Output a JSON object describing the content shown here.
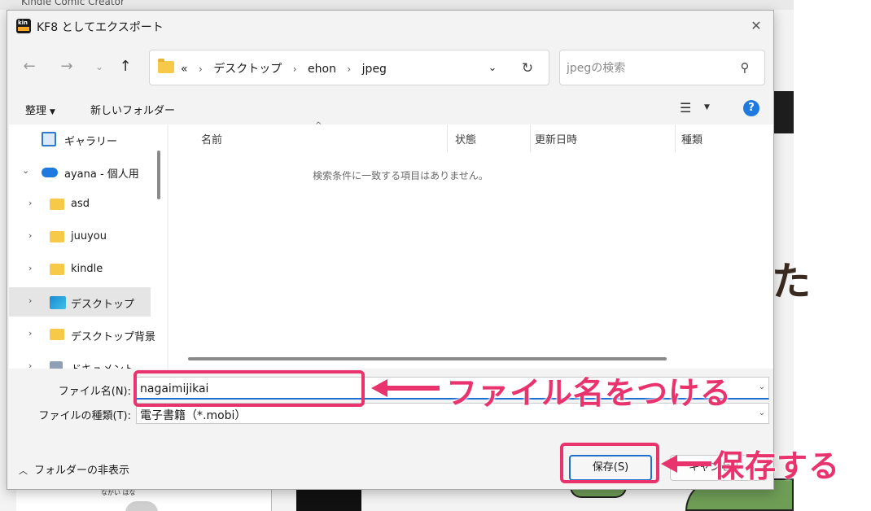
{
  "background_app": {
    "title": "Kindle Comic Creator",
    "partial_char": "た",
    "book_small_text": "ながい はな"
  },
  "dialog": {
    "title": "KF8 としてエクスポート",
    "close_glyph": "✕"
  },
  "address": {
    "overflow": "«",
    "path": [
      "デスクトップ",
      "ehon",
      "jpeg"
    ],
    "separator": "›"
  },
  "search": {
    "placeholder": "jpegの検索"
  },
  "commands": {
    "organize": "整理",
    "new_folder": "新しいフォルダー",
    "help": "?"
  },
  "nav_pane": {
    "items": [
      {
        "label": "ギャラリー",
        "icon": "gallery-icon",
        "has_chevron": false
      },
      {
        "label": "ayana - 個人用",
        "icon": "onedrive-cloud-icon",
        "has_chevron": true,
        "expanded": true
      },
      {
        "label": "asd",
        "icon": "folder-icon",
        "has_chevron": true
      },
      {
        "label": "juuyou",
        "icon": "folder-icon",
        "has_chevron": true
      },
      {
        "label": "kindle",
        "icon": "folder-icon",
        "has_chevron": true
      },
      {
        "label": "デスクトップ",
        "icon": "desktop-icon",
        "has_chevron": true,
        "selected": true
      },
      {
        "label": "デスクトップ背景",
        "icon": "folder-icon",
        "has_chevron": true
      },
      {
        "label": "ドキュメント",
        "icon": "documents-icon",
        "has_chevron": true
      }
    ]
  },
  "file_list": {
    "columns": [
      "名前",
      "状態",
      "更新日時",
      "種類"
    ],
    "empty_message": "検索条件に一致する項目はありません。"
  },
  "form": {
    "filename_label": "ファイル名(N):",
    "filename_value": "nagaimijikai",
    "filetype_label": "ファイルの種類(T):",
    "filetype_value": "電子書籍（*.mobi）"
  },
  "footer": {
    "hide_folders": "フォルダーの非表示",
    "save": "保存(S)",
    "cancel": "キャンセル"
  },
  "annotations": {
    "filename_note": "ファイル名をつける",
    "save_note": "保存する",
    "color": "#e8336d"
  }
}
